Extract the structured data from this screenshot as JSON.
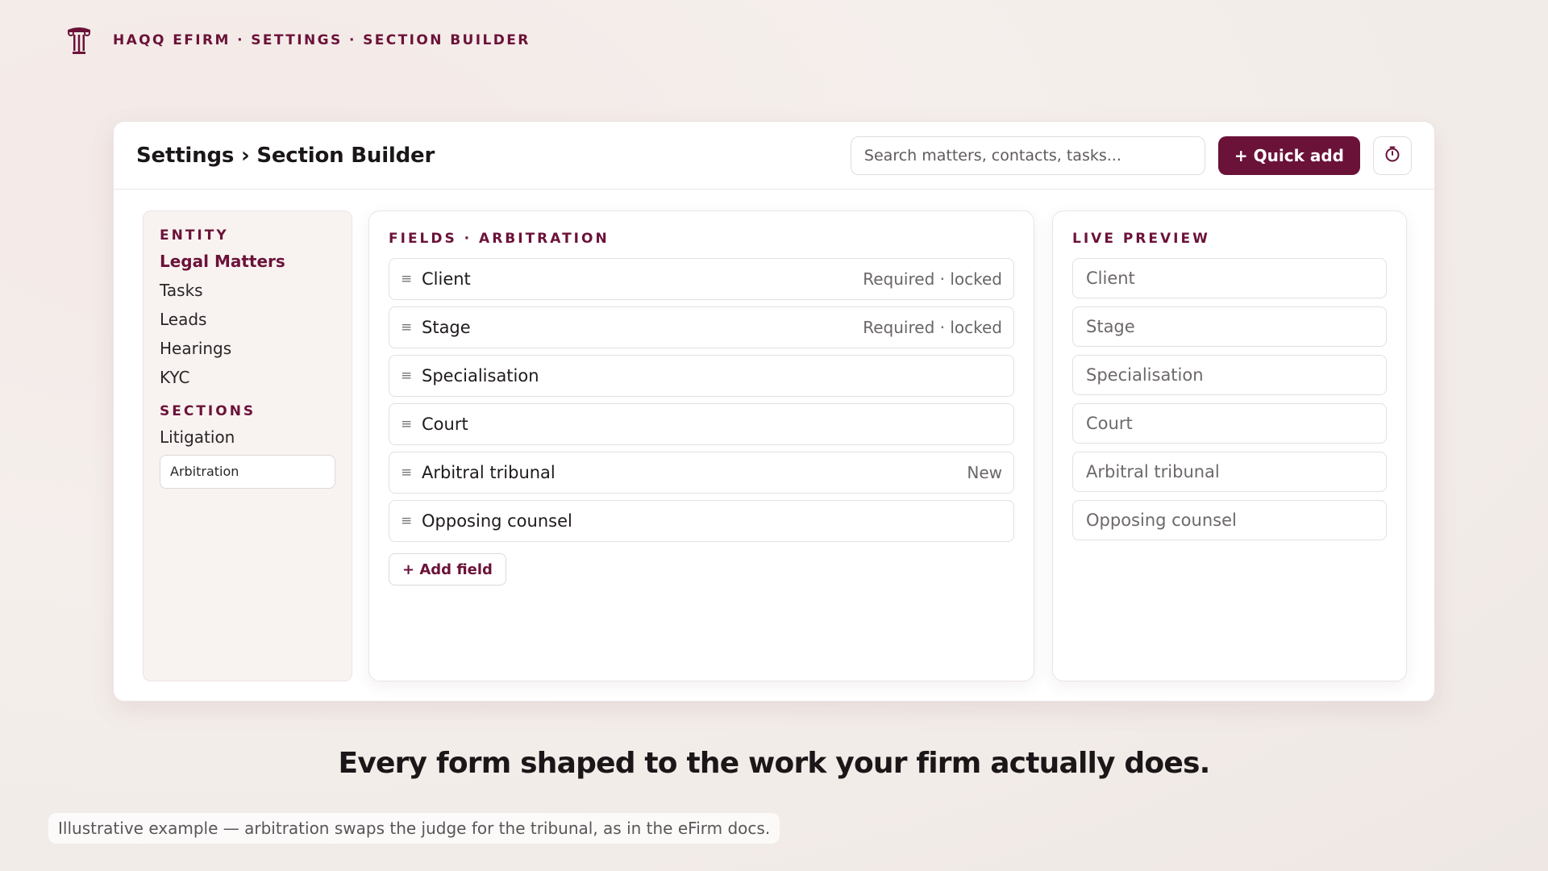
{
  "app": {
    "logo_icon": "pillar-icon",
    "top_breadcrumb": "HAQQ EFIRM · SETTINGS · SECTION BUILDER"
  },
  "header": {
    "title": "Settings › Section Builder",
    "search_placeholder": "Search matters, contacts, tasks...",
    "quick_add_label": "+ Quick add",
    "timer_icon": "stopwatch-icon"
  },
  "sidebar": {
    "entity_label": "ENTITY",
    "entities": [
      {
        "label": "Legal Matters",
        "active": true
      },
      {
        "label": "Tasks"
      },
      {
        "label": "Leads"
      },
      {
        "label": "Hearings"
      },
      {
        "label": "KYC"
      }
    ],
    "sections_label": "SECTIONS",
    "sections": [
      {
        "label": "Litigation"
      },
      {
        "label": "Arbitration",
        "selected": true
      }
    ]
  },
  "fields": {
    "label": "FIELDS · ARBITRATION",
    "handle_icon": "drag-handle-icon",
    "items": [
      {
        "name": "Client",
        "meta": "Required · locked"
      },
      {
        "name": "Stage",
        "meta": "Required · locked"
      },
      {
        "name": "Specialisation",
        "meta": ""
      },
      {
        "name": "Court",
        "meta": ""
      },
      {
        "name": "Arbitral tribunal",
        "meta": "New"
      },
      {
        "name": "Opposing counsel",
        "meta": ""
      }
    ],
    "add_label": "+ Add field"
  },
  "preview": {
    "label": "LIVE PREVIEW",
    "items": [
      "Client",
      "Stage",
      "Specialisation",
      "Court",
      "Arbitral tribunal",
      "Opposing counsel"
    ]
  },
  "tagline": "Every form shaped to the work your firm actually does.",
  "footnote": "Illustrative example — arbitration swaps the judge for the tribunal, as in the eFirm docs.",
  "colors": {
    "accent": "#6b1239",
    "background": "#f3ece9"
  }
}
